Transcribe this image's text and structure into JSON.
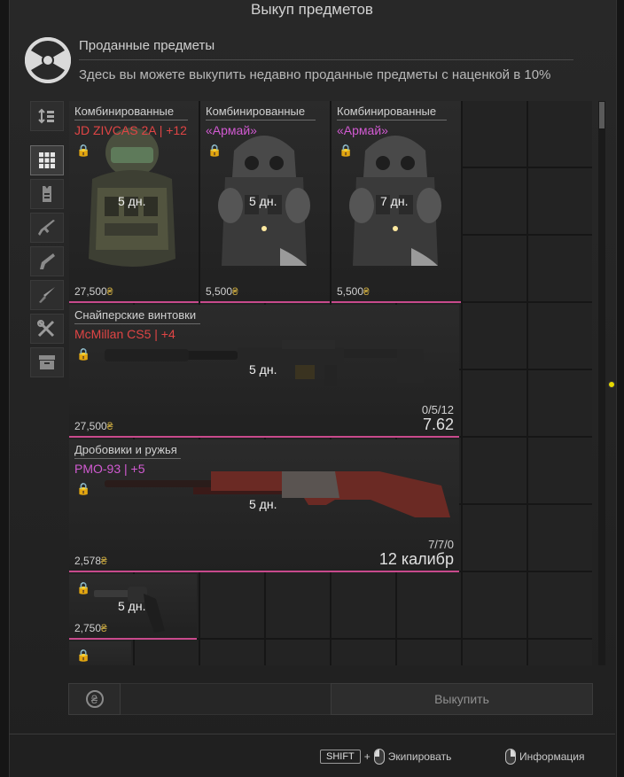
{
  "window": {
    "title": "Выкуп предметов"
  },
  "header": {
    "heading": "Проданные предметы",
    "description": "Здесь вы можете выкупить недавно проданные предметы с наценкой в 10%"
  },
  "tabs": [
    {
      "icon": "sort-icon"
    },
    {
      "icon": "grid-icon",
      "active": true
    },
    {
      "icon": "armor-icon"
    },
    {
      "icon": "rifle-icon"
    },
    {
      "icon": "pistol-icon"
    },
    {
      "icon": "knife-icon"
    },
    {
      "icon": "tools-icon"
    },
    {
      "icon": "box-icon"
    }
  ],
  "items": {
    "armor1": {
      "category": "Комбинированные",
      "name": "JD ZIVCAS 2A  |  +12",
      "days": "5 дн.",
      "price": "27,500"
    },
    "armor2": {
      "category": "Комбинированные",
      "name": "«Армай»",
      "days": "5 дн.",
      "price": "5,500"
    },
    "armor3": {
      "category": "Комбинированные",
      "name": "«Армай»",
      "days": "7 дн.",
      "price": "5,500"
    },
    "sniper": {
      "category": "Снайперские винтовки",
      "name": "McMillan CS5  |  +4",
      "days": "5 дн.",
      "price": "27,500",
      "ammo": "0/5/12",
      "caliber": "7.62"
    },
    "shotgun": {
      "category": "Дробовики и ружья",
      "name": "PMO-93  |  +5",
      "days": "5 дн.",
      "price": "2,578",
      "ammo": "7/7/0",
      "caliber": "12 калибр"
    },
    "revolver": {
      "days": "5 дн.",
      "price": "2,750"
    }
  },
  "currency_symbol": "₴",
  "lock_symbol": "🔒",
  "footer": {
    "buy_label": "Выкупить",
    "shift_key": "SHIFT",
    "plus": "+",
    "equip_label": "Экипировать",
    "info_label": "Информация"
  },
  "colors": {
    "accent_border": "#c84a8c",
    "pink_name": "#d25ad2",
    "red_name": "#e04545",
    "currency": "#c6a640"
  }
}
